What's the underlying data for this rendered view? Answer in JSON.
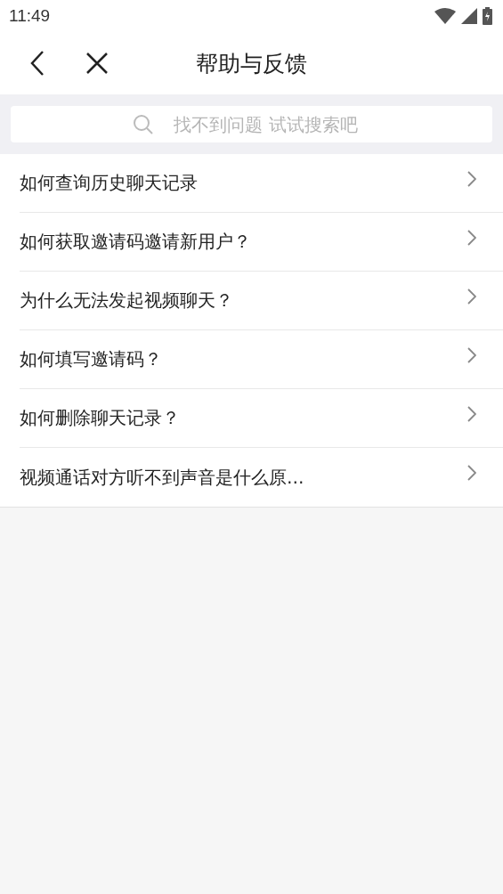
{
  "status_bar": {
    "time": "11:49"
  },
  "header": {
    "title": "帮助与反馈"
  },
  "search": {
    "placeholder": "找不到问题 试试搜索吧"
  },
  "questions": [
    {
      "text": "如何查询历史聊天记录"
    },
    {
      "text": "如何获取邀请码邀请新用户？"
    },
    {
      "text": "为什么无法发起视频聊天？"
    },
    {
      "text": "如何填写邀请码？"
    },
    {
      "text": "如何删除聊天记录？"
    },
    {
      "text": "视频通话对方听不到声音是什么原…"
    }
  ]
}
